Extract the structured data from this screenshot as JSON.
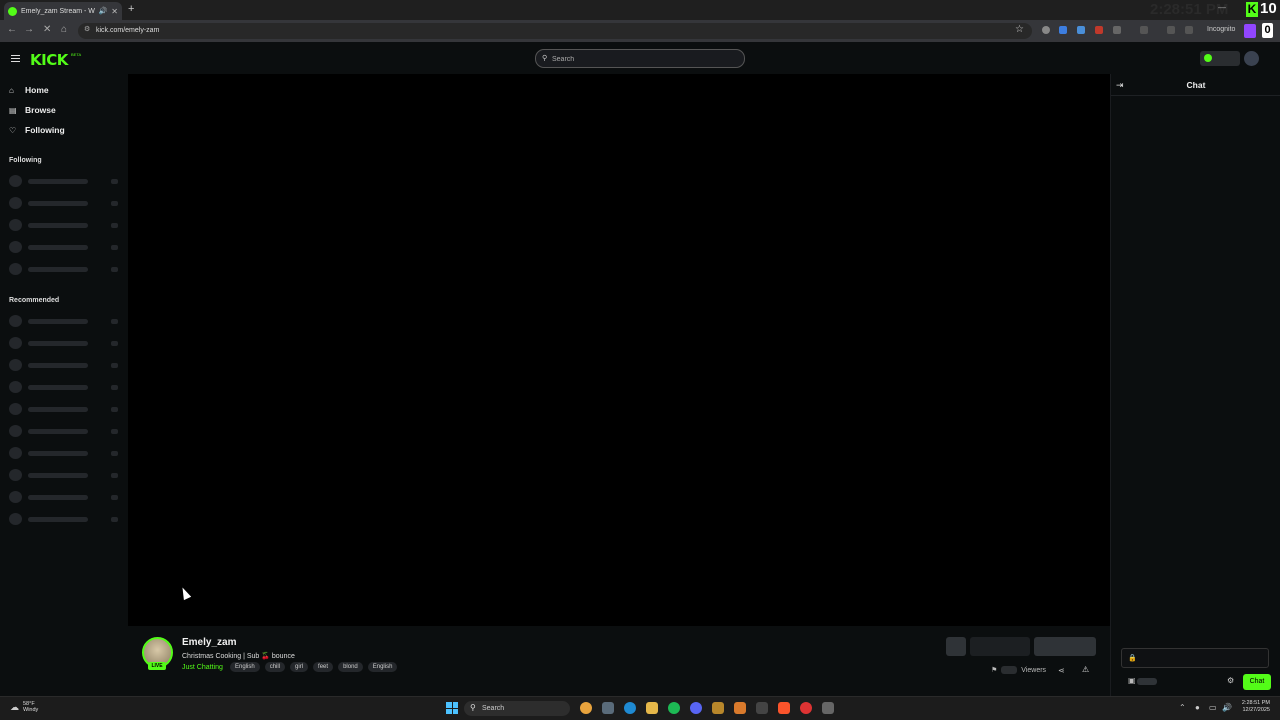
{
  "browser": {
    "tab_title": "Emely_zam Stream - Watch",
    "new_tab": "+",
    "url": "kick.com/emely-zam",
    "incognito": "Incognito",
    "overlay_clock": "2:28:51 PM",
    "kick_counter": "10",
    "twitch_counter": "0"
  },
  "header": {
    "logo": "KICK",
    "beta": "BETA",
    "search_placeholder": "Search"
  },
  "sidebar": {
    "nav": [
      {
        "label": "Home",
        "icon": "home-icon"
      },
      {
        "label": "Browse",
        "icon": "browse-icon"
      },
      {
        "label": "Following",
        "icon": "heart-icon"
      }
    ],
    "following_heading": "Following",
    "recommended_heading": "Recommended"
  },
  "stream": {
    "streamer": "Emely_zam",
    "live_badge": "LIVE",
    "title": "Christmas Cooking | Sub 🍒 bounce",
    "category": "Just Chatting",
    "tags": [
      "English",
      "chill",
      "girl",
      "feet",
      "blond",
      "English"
    ],
    "viewers_label": "Viewers"
  },
  "chat": {
    "title": "Chat",
    "send_label": "Chat"
  },
  "taskbar": {
    "temperature": "58°F",
    "weather": "Windy",
    "search": "Search",
    "time": "2:28:51 PM",
    "date": "12/27/2025"
  }
}
